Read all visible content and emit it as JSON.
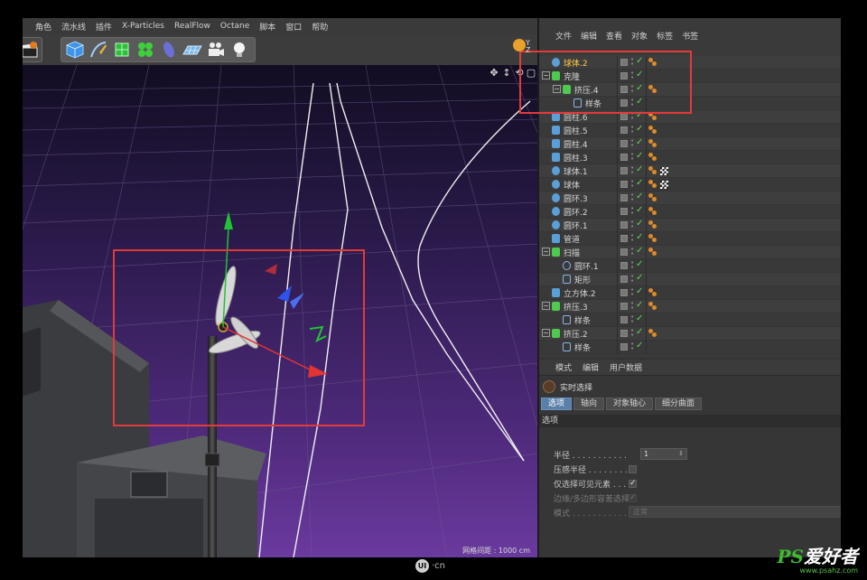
{
  "menubar": {
    "items": [
      "角色",
      "流水线",
      "插件",
      "X-Particles",
      "RealFlow",
      "Octane",
      "脚本",
      "窗口",
      "帮助"
    ]
  },
  "toolbar": {
    "tools": [
      "cube-icon",
      "pen-icon",
      "subdivide-icon",
      "cloner-icon",
      "deformer-icon",
      "floor-icon",
      "camera-icon",
      "light-icon"
    ]
  },
  "viewport": {
    "grid_label": "网格间距 : 1000 cm",
    "colors": {
      "background_top": "#15102a",
      "background_bottom": "#5b2f8a",
      "grid": "#6a5a8a",
      "axis_y": "#21c236",
      "axis_x": "#e23434",
      "axis_z": "#2f53e8"
    }
  },
  "object_manager": {
    "menu": [
      "文件",
      "编辑",
      "查看",
      "对象",
      "标签",
      "书签"
    ],
    "rows": [
      {
        "name": "球体.2",
        "active": true,
        "icon": "sphere-icon",
        "color": "#5a9fd8",
        "tags": [
          "orange"
        ]
      },
      {
        "name": "克隆",
        "active": false,
        "icon": "cloner-icon",
        "color": "#4fc94f",
        "tags": []
      },
      {
        "name": "挤压.4",
        "active": false,
        "icon": "extrude-icon",
        "color": "#4fc94f",
        "tags": [
          "orange"
        ]
      },
      {
        "name": "样条",
        "active": false,
        "icon": "spline-icon",
        "color": "#8ab4e8",
        "tags": []
      },
      {
        "name": "圆柱.6",
        "active": false,
        "icon": "cylinder-icon",
        "color": "#5a9fd8",
        "tags": [
          "orange"
        ]
      },
      {
        "name": "圆柱.5",
        "active": false,
        "icon": "cylinder-icon",
        "color": "#5a9fd8",
        "tags": [
          "orange"
        ]
      },
      {
        "name": "圆柱.4",
        "active": false,
        "icon": "cylinder-icon",
        "color": "#5a9fd8",
        "tags": [
          "orange"
        ]
      },
      {
        "name": "圆柱.3",
        "active": false,
        "icon": "cylinder-icon",
        "color": "#5a9fd8",
        "tags": [
          "orange"
        ]
      },
      {
        "name": "球体.1",
        "active": false,
        "icon": "sphere-icon",
        "color": "#5a9fd8",
        "tags": [
          "orange",
          "checker"
        ]
      },
      {
        "name": "球体",
        "active": false,
        "icon": "sphere-icon",
        "color": "#5a9fd8",
        "tags": [
          "orange",
          "checker"
        ]
      },
      {
        "name": "圆环.3",
        "active": false,
        "icon": "torus-icon",
        "color": "#5a9fd8",
        "tags": [
          "orange"
        ]
      },
      {
        "name": "圆环.2",
        "active": false,
        "icon": "torus-icon",
        "color": "#5a9fd8",
        "tags": [
          "orange"
        ]
      },
      {
        "name": "圆环.1",
        "active": false,
        "icon": "torus-icon",
        "color": "#5a9fd8",
        "tags": [
          "orange"
        ]
      },
      {
        "name": "管道",
        "active": false,
        "icon": "tube-icon",
        "color": "#5a9fd8",
        "tags": [
          "orange"
        ]
      },
      {
        "name": "扫描",
        "active": false,
        "icon": "sweep-icon",
        "color": "#4fc94f",
        "tags": [
          "orange"
        ]
      },
      {
        "name": "圆环.1",
        "active": false,
        "icon": "circle-spline-icon",
        "color": "#8ab4e8",
        "tags": []
      },
      {
        "name": "矩形",
        "active": false,
        "icon": "rectangle-spline-icon",
        "color": "#8ab4e8",
        "tags": []
      },
      {
        "name": "立方体.2",
        "active": false,
        "icon": "cube-icon",
        "color": "#5a9fd8",
        "tags": [
          "orange"
        ]
      },
      {
        "name": "挤压.3",
        "active": false,
        "icon": "extrude-icon",
        "color": "#4fc94f",
        "tags": [
          "orange"
        ]
      },
      {
        "name": "样条",
        "active": false,
        "icon": "spline-icon",
        "color": "#8ab4e8",
        "tags": []
      },
      {
        "name": "挤压.2",
        "active": false,
        "icon": "extrude-icon",
        "color": "#4fc94f",
        "tags": [
          "orange"
        ]
      },
      {
        "name": "样条",
        "active": false,
        "icon": "spline-icon",
        "color": "#8ab4e8",
        "tags": []
      }
    ]
  },
  "attribute_manager": {
    "menu": [
      "模式",
      "编辑",
      "用户数据"
    ],
    "title": "实时选择",
    "tabs": [
      "选项",
      "轴向",
      "对象轴心",
      "细分曲面"
    ],
    "section": "选项",
    "fields": {
      "radius_label": "半径 . . . . . . . . . . .",
      "radius_value": "1",
      "pressure_label": "压感半径 . . . . . . . . .",
      "visible_only_label": "仅选择可见元素 . . . .",
      "edge_poly_label": "边缘/多边形容差选择",
      "mode_label": "模式 . . . . . . . . . . .",
      "mode_value": "正常"
    }
  },
  "footer": {
    "logo_text": "UI",
    "logo_suffix": "·cn",
    "watermark": "PS爱好者",
    "watermark_ps": "PS",
    "watermark_rest": "爱好者",
    "watermark_url": "www.psahz.com"
  }
}
